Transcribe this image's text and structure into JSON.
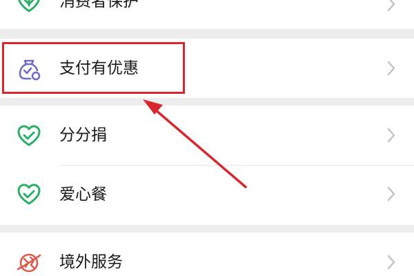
{
  "menu": {
    "items": [
      {
        "label": "消费者保护",
        "icon": "heart-shield-icon"
      },
      {
        "label": "支付有优惠",
        "icon": "bag-check-icon"
      },
      {
        "label": "分分捐",
        "icon": "heart-check-icon"
      },
      {
        "label": "爱心餐",
        "icon": "heart-check-icon"
      },
      {
        "label": "境外服务",
        "icon": "globe-plane-icon"
      }
    ]
  },
  "colors": {
    "green_icon": "#2bae67",
    "purple_icon": "#6f6cc9",
    "red_icon": "#e0574a",
    "annotation_red": "#d9262e",
    "chevron": "#bfbfbf"
  },
  "annotation": {
    "highlighted_item": "支付有优惠",
    "arrow_icon": "arrow-icon"
  }
}
